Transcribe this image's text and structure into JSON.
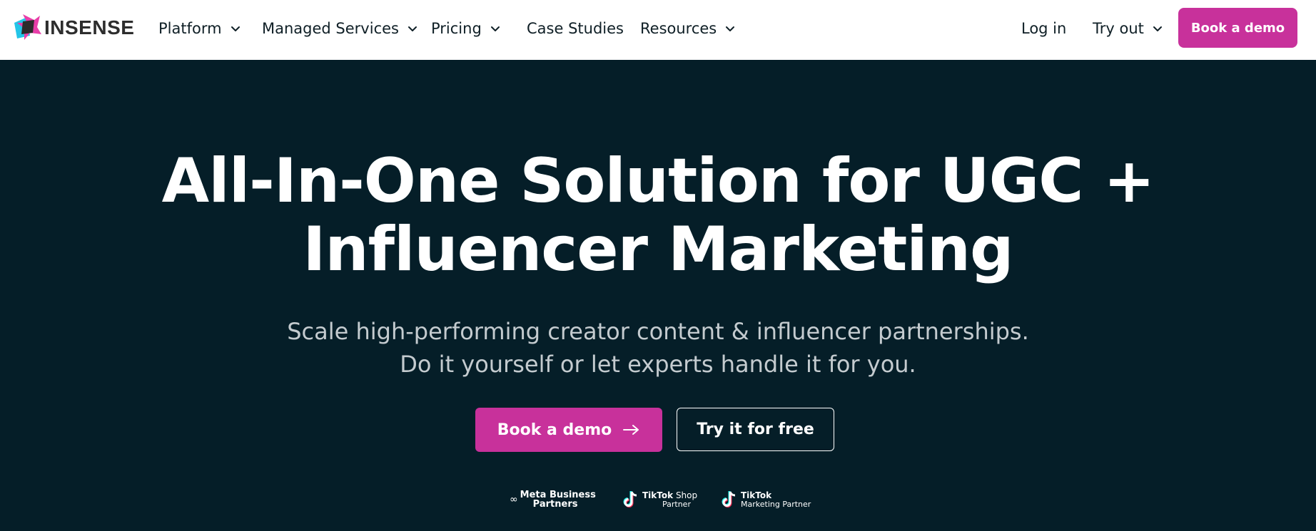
{
  "nav": {
    "logo_text": "INSENSE",
    "items": [
      {
        "label": "Platform",
        "has_dropdown": true
      },
      {
        "label": "Managed Services",
        "has_dropdown": true
      },
      {
        "label": "Pricing",
        "has_dropdown": true
      },
      {
        "label": "Case Studies",
        "has_dropdown": false
      },
      {
        "label": "Resources",
        "has_dropdown": true
      }
    ],
    "login_label": "Log in",
    "try_out_label": "Try out",
    "cta_label": "Book a demo"
  },
  "hero": {
    "headline_line1": "All-In-One Solution for UGC +",
    "headline_line2": "Influencer Marketing",
    "subtitle_line1": "Scale high-performing creator content & influencer partnerships.",
    "subtitle_line2": "Do it yourself or let experts handle it for you.",
    "primary_button": "Book a demo",
    "secondary_button": "Try it for free"
  },
  "partners": {
    "meta_line1": "Meta Business",
    "meta_line2": "Partners",
    "tiktok_shop_brand": "TikTok",
    "tiktok_shop_word": "Shop",
    "tiktok_shop_sub": "Partner",
    "tiktok_marketing_brand": "TikTok",
    "tiktok_marketing_sub": "Marketing Partner"
  },
  "colors": {
    "accent": "#c8319b",
    "hero_bg": "#051e28",
    "nav_bg": "#ffffff"
  }
}
